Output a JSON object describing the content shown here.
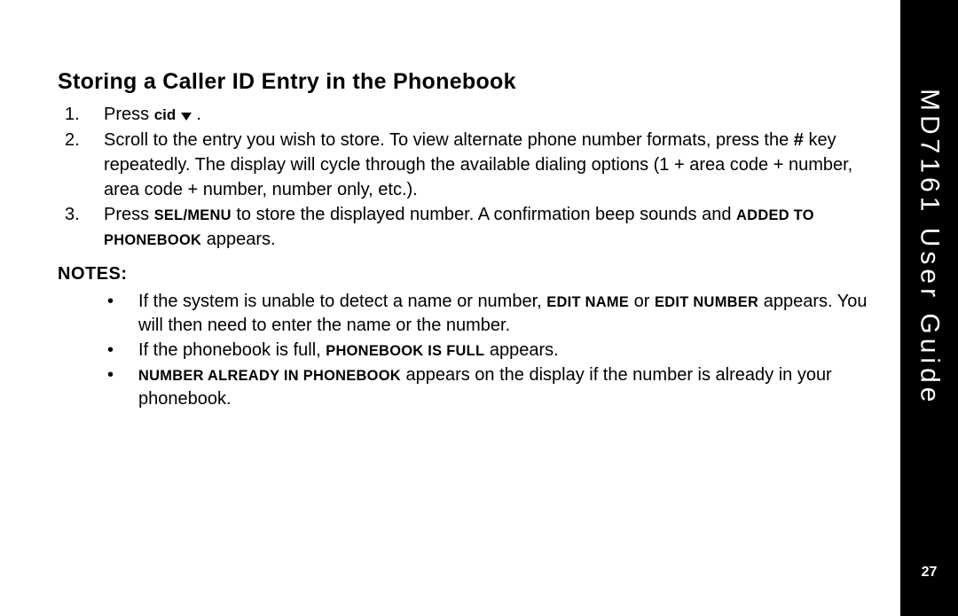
{
  "sidebar": {
    "title": "MD7161 User Guide",
    "page_number": "27"
  },
  "section": {
    "title": "Storing a Caller ID Entry in the Phonebook"
  },
  "steps": [
    {
      "num": "1.",
      "prefix": "Press ",
      "key": "cid",
      "icon": "down-triangle",
      "suffix": " ."
    },
    {
      "num": "2.",
      "text_parts": [
        {
          "t": "Scroll to the entry you wish to store. To view alternate phone number formats, press the "
        },
        {
          "t": "#",
          "bold": true
        },
        {
          "t": " key repeatedly. The display will cycle through the available dialing options (1 + area code + number, area code + number, number only, etc.)."
        }
      ]
    },
    {
      "num": "3.",
      "text_parts": [
        {
          "t": "Press "
        },
        {
          "t": "SEL/MENU",
          "bold": true,
          "small": true
        },
        {
          "t": " to store the displayed number. A confirmation beep sounds and "
        },
        {
          "t": "ADDED TO PHONEBOOK",
          "bold": true,
          "small": true
        },
        {
          "t": " appears."
        }
      ]
    }
  ],
  "notes_label": "NOTES:",
  "notes": [
    {
      "parts": [
        {
          "t": "If the system is unable to detect a name or number, "
        },
        {
          "t": "EDIT NAME",
          "bold": true,
          "small": true
        },
        {
          "t": " or "
        },
        {
          "t": "EDIT NUMBER",
          "bold": true,
          "small": true
        },
        {
          "t": " appears. You will then need to enter the name or the number."
        }
      ]
    },
    {
      "parts": [
        {
          "t": "If the phonebook is full, "
        },
        {
          "t": "PHONEBOOK IS FULL",
          "bold": true,
          "small": true
        },
        {
          "t": " appears."
        }
      ]
    },
    {
      "parts": [
        {
          "t": "NUMBER ALREADY IN PHONEBOOK",
          "bold": true,
          "small": true
        },
        {
          "t": " appears on the display if the number is already in your phonebook."
        }
      ]
    }
  ]
}
